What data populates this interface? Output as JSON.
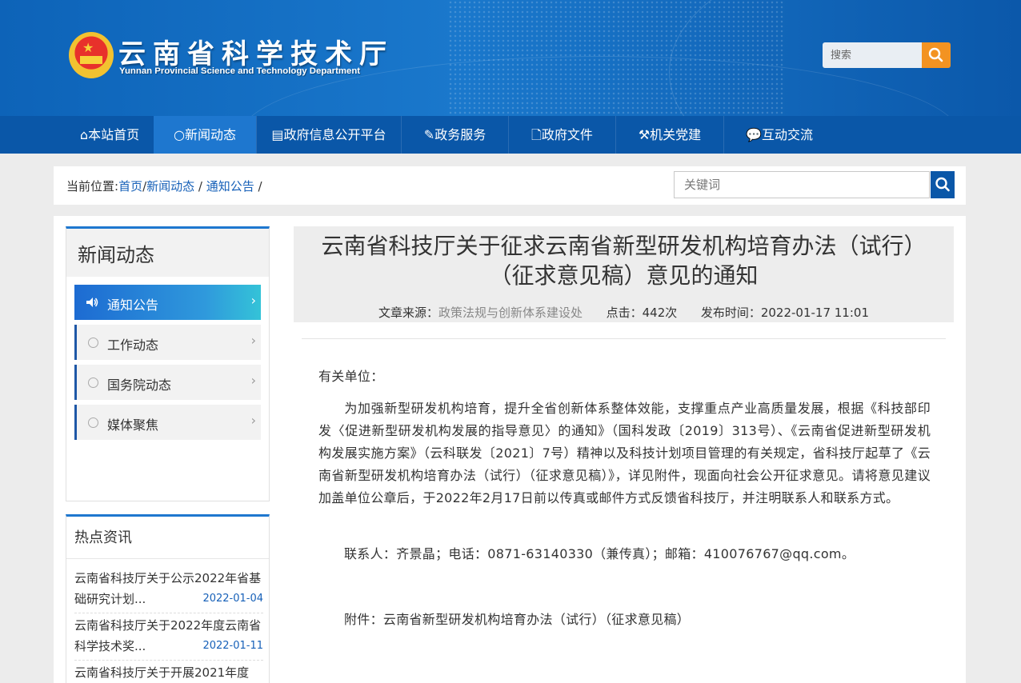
{
  "header": {
    "title": "云南省科学技术厅",
    "subtitle": "Yunnan Provincial Science and Technology Department",
    "search_placeholder": "搜索",
    "emblem_icon": "national-emblem",
    "search_icon": "search-icon"
  },
  "nav": {
    "items": [
      {
        "label": "本站首页",
        "icon": "home-icon"
      },
      {
        "label": "新闻动态",
        "icon": "circle-icon",
        "active": true
      },
      {
        "label": "政府信息公开平台",
        "icon": "monitor-icon"
      },
      {
        "label": "政务服务",
        "icon": "edit-icon"
      },
      {
        "label": "政府文件",
        "icon": "file-icon"
      },
      {
        "label": "机关党建",
        "icon": "hammer-icon"
      },
      {
        "label": "互动交流",
        "icon": "chat-icon"
      }
    ]
  },
  "breadcrumb": {
    "prefix": "当前位置:",
    "home": "首页",
    "news": "新闻动态",
    "current": "通知公告",
    "keyword_placeholder": "关键词"
  },
  "sidebar": {
    "title": "新闻动态",
    "items": [
      {
        "label": "通知公告",
        "active": true
      },
      {
        "label": "工作动态"
      },
      {
        "label": "国务院动态"
      },
      {
        "label": "媒体聚焦"
      }
    ]
  },
  "hot": {
    "title": "热点资讯",
    "items": [
      {
        "title": "云南省科技厅关于公示2022年省基础研究计划...",
        "date": "2022-01-04"
      },
      {
        "title": "云南省科技厅关于2022年度云南省科学技术奖...",
        "date": "2022-01-11"
      },
      {
        "title": "云南省科技厅关于开展2021年度",
        "date": ""
      }
    ]
  },
  "article": {
    "title": "云南省科技厅关于征求云南省新型研发机构培育办法（试行）（征求意见稿）意见的通知",
    "source_label": "文章来源：",
    "source": "政策法规与创新体系建设处",
    "clicks": "点击：442次",
    "published": "发布时间：2022-01-17 11:01",
    "greeting": "有关单位：",
    "body": "为加强新型研发机构培育，提升全省创新体系整体效能，支撑重点产业高质量发展，根据《科技部印发〈促进新型研发机构发展的指导意见〉的通知》（国科发政〔2019〕313号）、《云南省促进新型研发机构发展实施方案》（云科联发〔2021〕7号）精神以及科技计划项目管理的有关规定，省科技厅起草了《云南省新型研发机构培育办法（试行）（征求意见稿）》，详见附件，现面向社会公开征求意见。请将意见建议加盖单位公章后，于2022年2月17日前以传真或邮件方式反馈省科技厅，并注明联系人和联系方式。",
    "contact": "联系人：齐景晶；电话：0871-63140330（兼传真）；邮箱：410076767@qq.com。",
    "attachment": "附件：云南省新型研发机构培育办法（试行）（征求意见稿）"
  },
  "colors": {
    "header_blue": "#0d63b8",
    "nav_blue": "#0a57a8",
    "nav_active": "#1e77cf",
    "search_orange": "#f39321",
    "link_blue": "#1660b8"
  }
}
